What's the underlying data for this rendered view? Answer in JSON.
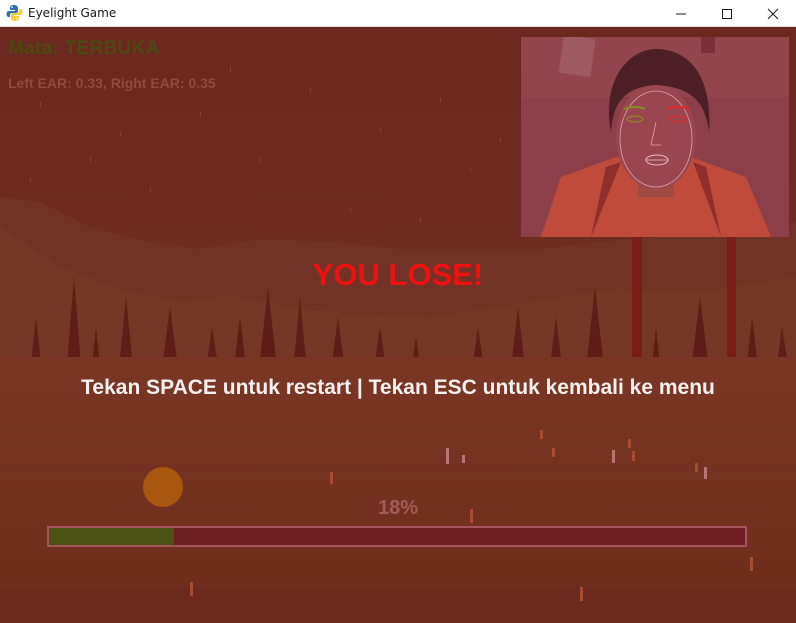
{
  "window": {
    "title": "Eyelight Game",
    "app_icon": "python-icon",
    "controls": {
      "minimize_icon": "minimize-icon",
      "maximize_icon": "maximize-icon",
      "close_icon": "close-icon"
    }
  },
  "hud": {
    "eye_status": "Mata: TERBUKA",
    "ear_readout": "Left EAR: 0.33, Right EAR: 0.35"
  },
  "webcam": {
    "label_icon": "webcam-feed-icon"
  },
  "game_over": {
    "message": "YOU LOSE!",
    "instructions": "Tekan SPACE untuk restart | Tekan ESC untuk kembali ke menu"
  },
  "progress": {
    "label": "18%",
    "value": 0.18
  },
  "colors": {
    "lose": "#f01010",
    "status": "#4d4a10",
    "progress_fill": "#4c5214",
    "progress_track": "#6e1e22",
    "player": "#a8570e"
  }
}
